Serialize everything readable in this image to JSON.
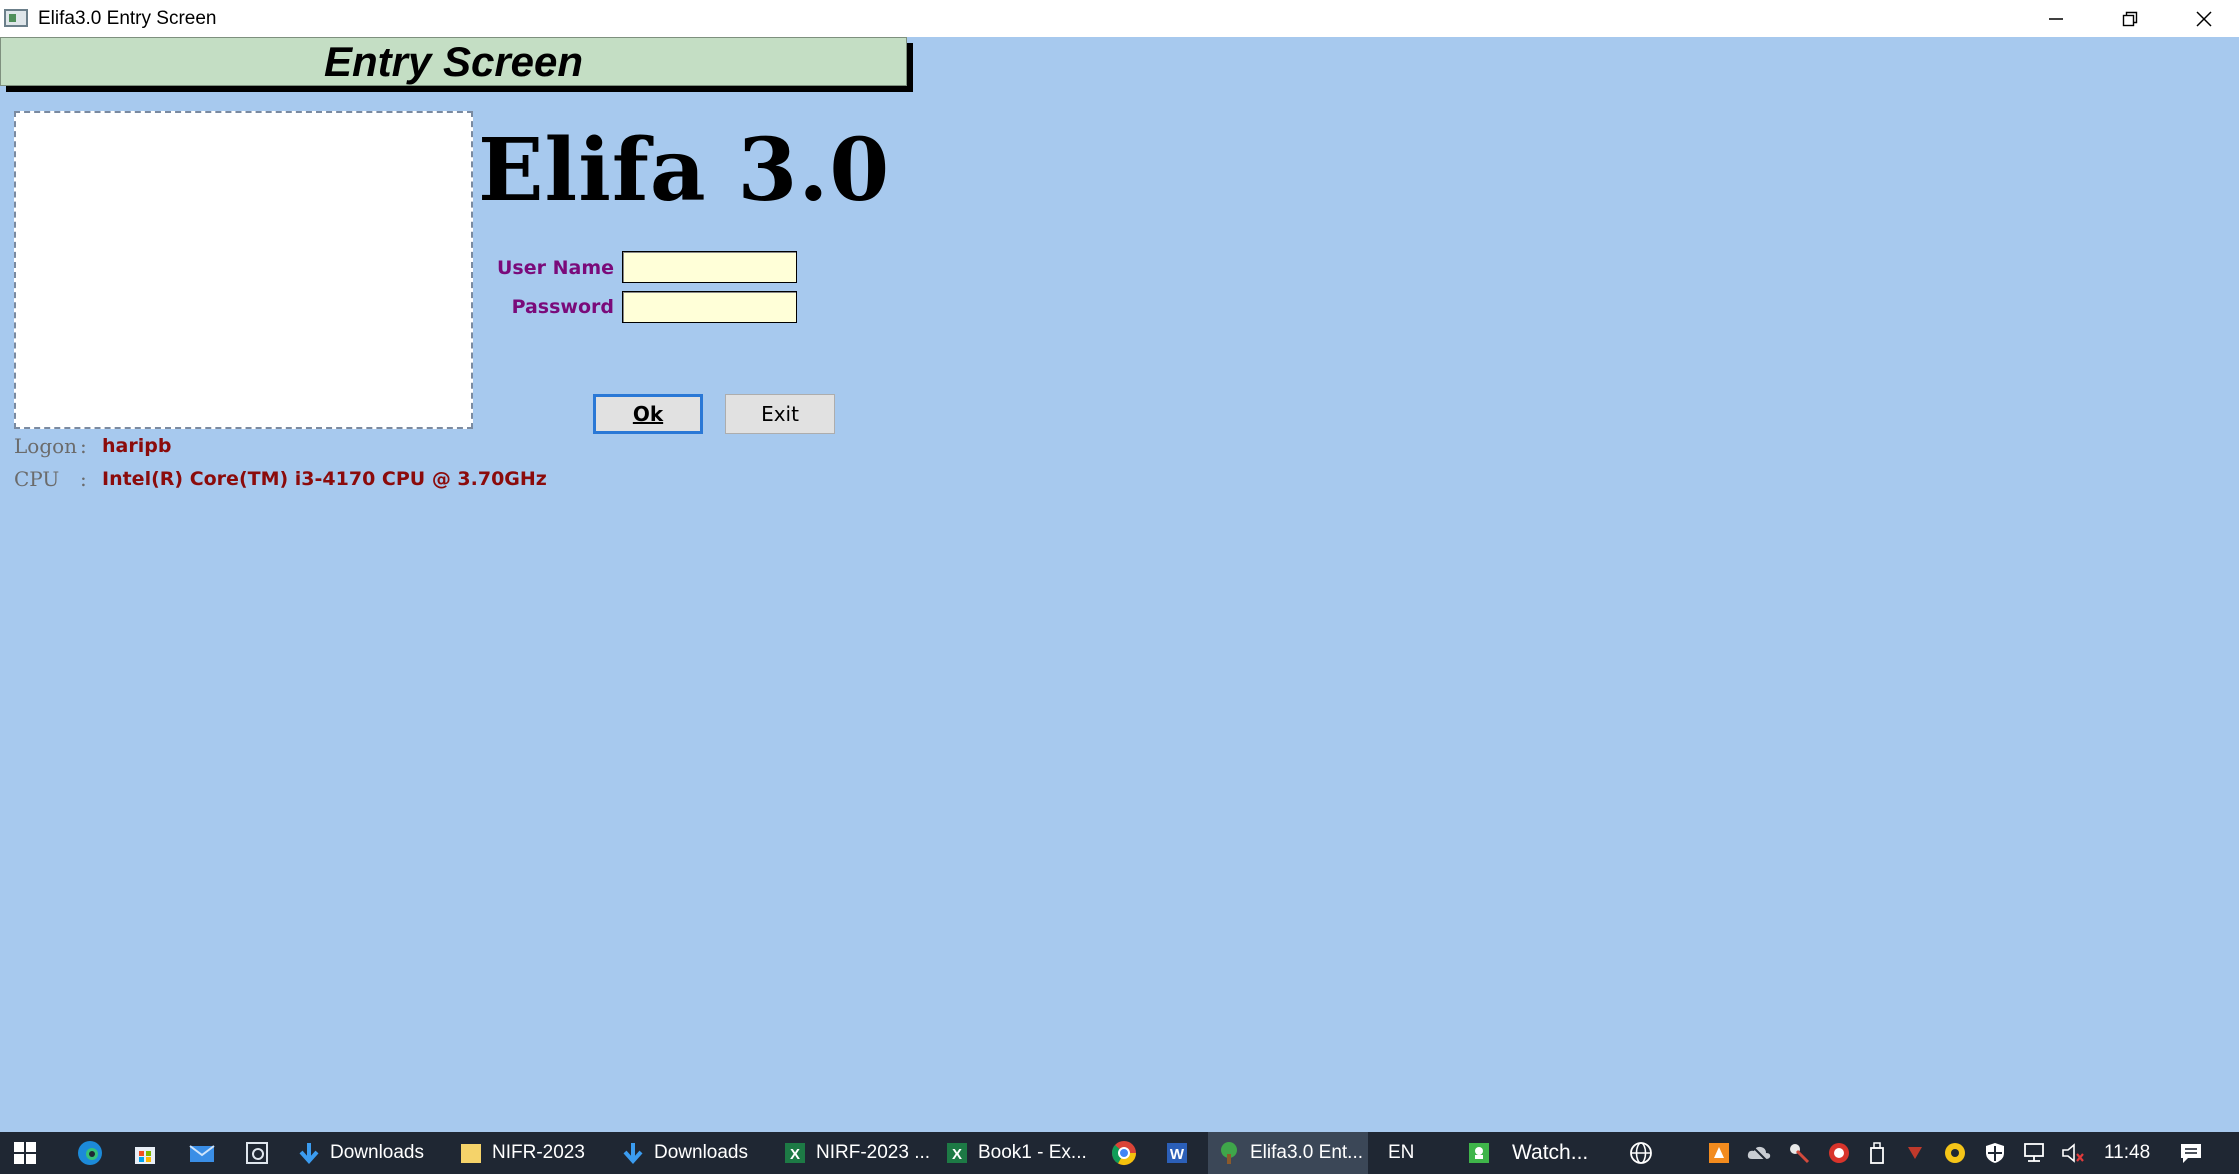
{
  "window": {
    "title": "Elifa3.0 Entry Screen",
    "controls": [
      "minimize-icon",
      "restore-icon",
      "close-icon"
    ]
  },
  "header": {
    "title": "Entry Screen"
  },
  "app_name": "Elifa 3.0",
  "form": {
    "username_label": "User Name",
    "username_value": "",
    "password_label": "Password",
    "password_value": "",
    "ok_label": "Ok",
    "exit_label": "Exit"
  },
  "info": {
    "logon_key": "Logon",
    "logon_value": "haripb",
    "cpu_key": "CPU",
    "cpu_value": "Intel(R) Core(TM) i3-4170 CPU @ 3.70GHz",
    "separator": ":"
  },
  "taskbar": {
    "items": [
      {
        "label": "Downloads",
        "icon": "download-arrow-icon"
      },
      {
        "label": "NIFR-2023",
        "icon": "folder-icon"
      },
      {
        "label": "Downloads",
        "icon": "download-arrow-icon"
      },
      {
        "label": "NIRF-2023 ...",
        "icon": "excel-icon"
      },
      {
        "label": "Book1 - Ex...",
        "icon": "excel-icon"
      },
      {
        "label": "Elifa3.0 Ent...",
        "icon": "elifa-tree-icon"
      },
      {
        "label": "Watch...",
        "icon": "watch-app-icon"
      }
    ],
    "language": "EN",
    "clock": "11:48"
  },
  "colors": {
    "background": "#a7c9ee",
    "header_band": "#c4dec4",
    "label_purple": "#7a0a7a",
    "value_red": "#8b0b0b",
    "input_yellow": "#ffffd8",
    "ok_border": "#2a78d6",
    "taskbar": "#1f2733"
  }
}
